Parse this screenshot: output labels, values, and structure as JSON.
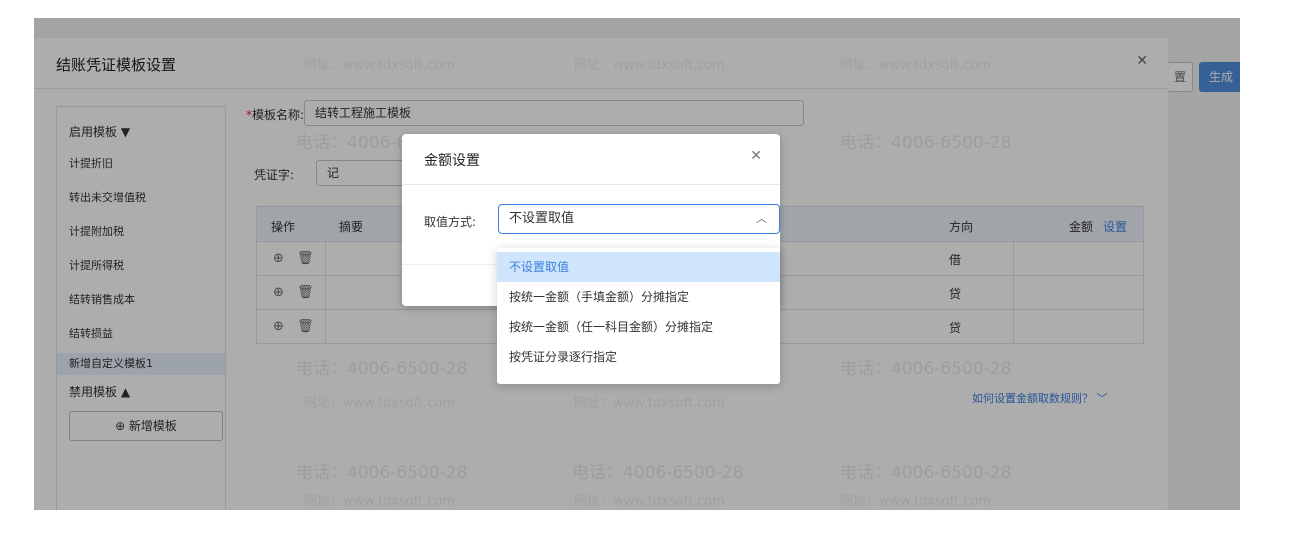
{
  "base_window": {
    "edge_button_label": "置",
    "generate_button_label": "生成"
  },
  "dialog": {
    "title": "结账凭证模板设置",
    "sidebar": {
      "enabled_group_label": "启用模板 ▼",
      "items": [
        "计提折旧",
        "转出未交增值税",
        "计提附加税",
        "计提所得税",
        "结转销售成本",
        "结转损益",
        "新增自定义模板1"
      ],
      "disabled_group_label": "禁用模板 ▲",
      "add_button_label": "⊕ 新增模板"
    },
    "form": {
      "required_mark": "*",
      "name_label": "模板名称:",
      "name_value": "结转工程施工模板",
      "voucher_label": "凭证字:",
      "voucher_value": "记"
    },
    "table": {
      "headers": {
        "op": "操作",
        "summary": "摘要",
        "direction": "方向",
        "amount": "金额",
        "settings": "设置"
      },
      "rows": [
        {
          "direction": "借"
        },
        {
          "direction": "贷"
        },
        {
          "direction": "贷"
        }
      ]
    },
    "rule_link": "如何设置金额取数规则？ ﹀"
  },
  "watermark": {
    "phone": "电话：4006-6500-28",
    "site": "网址：www.tdxsoft.com"
  },
  "modal": {
    "title": "金额设置",
    "value_mode_label": "取值方式:",
    "selected_value": "不设置取值",
    "options": [
      "不设置取值",
      "按统一金额（手填金额）分摊指定",
      "按统一金额（任一科目金额）分摊指定",
      "按凭证分录逐行指定"
    ],
    "selected_index": 0
  }
}
